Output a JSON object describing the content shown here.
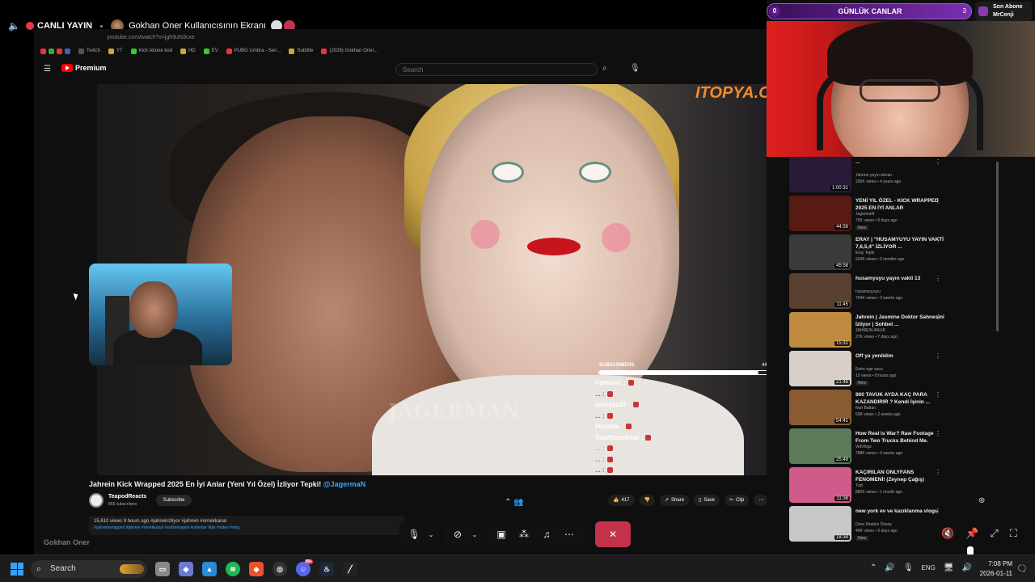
{
  "share_bar": {
    "live_label": "CANLI YAYIN",
    "screen_title": "Gokhan Oner Kullanıcısının Ekranı"
  },
  "browser": {
    "url": "youtube.com/watch?v=jgh9uN3cxe",
    "bookmarks": [
      "Twitch",
      "YT",
      "Kick Abone kod",
      "HD",
      "EV",
      "PUBG Umbra - Sen...",
      "Subtitle",
      "(2026) Gokhan Oner..."
    ]
  },
  "youtube": {
    "logo_text": "Premium",
    "search_placeholder": "Search"
  },
  "video": {
    "watermark": "JAGERMAN",
    "sponsor": "ITOPYA.CO",
    "subs_goal": {
      "label": "SUBSCRIBERS",
      "count_text": "44 / 50",
      "progress": 0.88
    },
    "chat": [
      {
        "user": "iremanic :",
        "color": "#ffffff"
      },
      {
        "user": "... :",
        "color": "#e83838"
      },
      {
        "user": "zehraaa33 :",
        "color": "#ffffff"
      },
      {
        "user": "... :",
        "color": "#9a5ad0"
      },
      {
        "user": "iluvenis :",
        "color": "#ffffff"
      },
      {
        "user": "VasifflessKedi :",
        "color": "#ffffff"
      },
      {
        "user": "... :",
        "color": "#e8a0a0"
      },
      {
        "user": "... :",
        "color": "#a070e0"
      },
      {
        "user": "... :",
        "color": "#e83838"
      }
    ]
  },
  "video_info": {
    "title": "Jahrein Kick Wrapped 2025 En İyi Anlar (Yeni Yıl Özel) İzliyor Tepki!",
    "mention": "@JagermaN",
    "channel": "TeapodReacts",
    "subscribers": "855 subscribers",
    "subscribe_label": "Subscribe",
    "likes": "417",
    "share_label": "Share",
    "save_label": "Save",
    "clip_label": "Clip",
    "desc_meta": "15,610 views  9 hours ago  #jahreinizliyor #jahrein #ornekkanal",
    "desc_tags": "#yahreinwrapped #jahrein #ornekkanal #sohbetyayini #videolar #tak #video #vlog"
  },
  "bottom_name": "Gokhan Oner",
  "goal": {
    "left_value": "0",
    "title": "GÜNLÜK CANLAR",
    "right_value": "3"
  },
  "last_sub": {
    "line1": "Son Abone",
    "line2": "MrCenji"
  },
  "related": [
    {
      "title": "...",
      "channel": "Jahrein yayın tekrarı",
      "meta": "295K views • 4 years ago",
      "duration": "1:00:31",
      "badge": "",
      "thumb": "#2a1a3a"
    },
    {
      "title": "YENİ YIL ÖZEL - KICK WRAPPED 2025 EN İYİ ANLAR",
      "channel": "JagermaN",
      "meta": "75K views • 6 days ago",
      "duration": "44:56",
      "badge": "New",
      "thumb": "#5a1a14"
    },
    {
      "title": "ERAY | \"HUSAMYUYU YAYIN VAKTİ 7,6,5,4\" İZLİYOR ...",
      "channel": "Eray Tepki",
      "meta": "924K views • 2 months ago",
      "duration": "45:58",
      "badge": "",
      "thumb": "#3a3a3a"
    },
    {
      "title": "husamyuyu yayın vakti 13",
      "channel": "husamyuyuyu",
      "meta": "764K views • 2 weeks ago",
      "duration": "11:45",
      "badge": "",
      "thumb": "#5a4030"
    },
    {
      "title": "Jahrein | Jasmine Doktor Sahnesini İzliyor | Sohbet ...",
      "channel": "JAHREIN ANLIK",
      "meta": "27K views • 7 days ago",
      "duration": "15:31",
      "badge": "",
      "thumb": "#c08a40"
    },
    {
      "title": "Off ya yenildim",
      "channel": "Entre ege sucu",
      "meta": "10 views • 8 hours ago",
      "duration": "21:46",
      "badge": "New",
      "thumb": "#d8d0c8"
    },
    {
      "title": "900 TAVUK AYDA KAÇ PARA KAZANDIRIR ? Kendi İşinin ...",
      "channel": "Nuri Battan",
      "meta": "63K views • 2 weeks ago",
      "duration": "54:41",
      "badge": "",
      "thumb": "#8a5a30"
    },
    {
      "title": "How Real is War? Raw Footage From Two Trucks Behind Me.",
      "channel": "VetVlogz",
      "meta": "788K views • 4 weeks ago",
      "duration": "25:49",
      "badge": "",
      "thumb": "#5a7a5a"
    },
    {
      "title": "KAÇIRILAN ONLYFANS FENOMENİ! (Zeynep Çağış)",
      "channel": "Tuzi",
      "meta": "882K views • 1 month ago",
      "duration": "11:38",
      "badge": "",
      "thumb": "#d05a8a"
    },
    {
      "title": "new york ev ve kazıklanma vlogu",
      "channel": "Dora Stratins Özsoy",
      "meta": "40K views • 5 days ago",
      "duration": "18:34",
      "badge": "New",
      "thumb": "#c8c8c8"
    }
  ],
  "call_controls": {
    "leave_label": "✕"
  },
  "taskbar": {
    "search_label": "Search",
    "lang": "ENG",
    "time": "7:08 PM",
    "date": "2026-01-11",
    "discord_badge": "99+"
  }
}
